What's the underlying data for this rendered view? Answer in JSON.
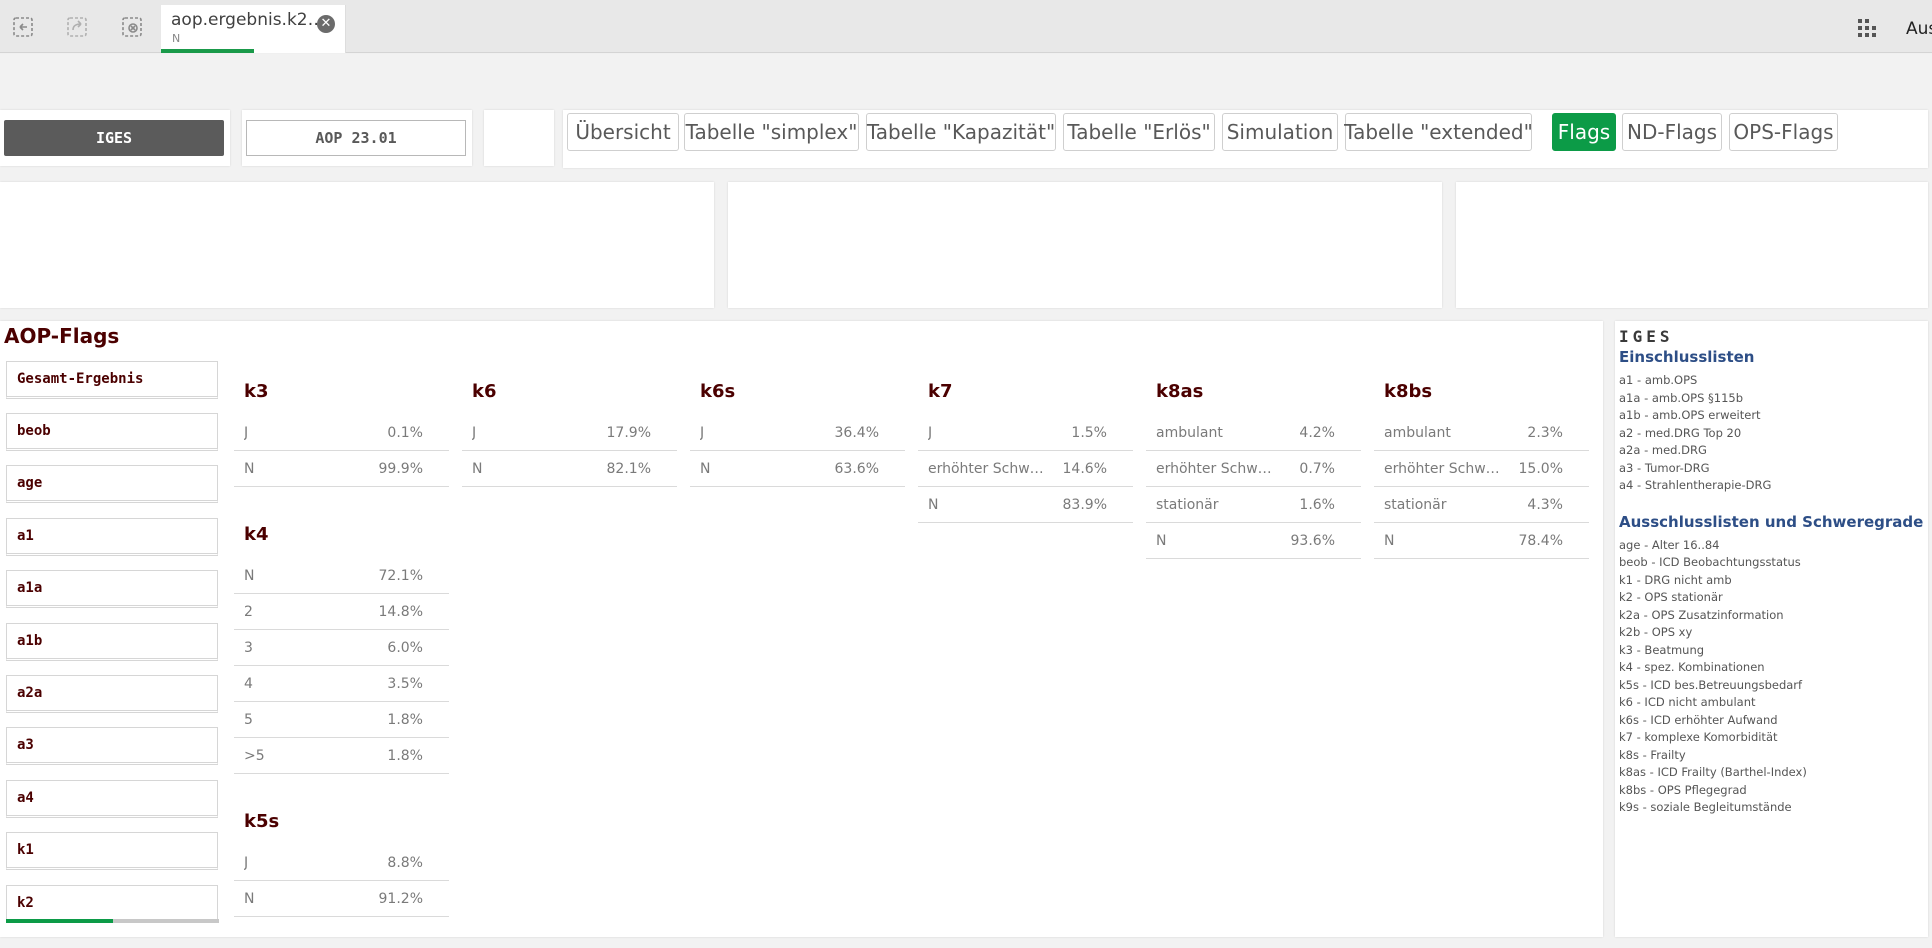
{
  "topbar": {
    "sheet_title": "aop.ergebnis.k2…",
    "sheet_sub": "N",
    "right_text": "Aus"
  },
  "selectors": {
    "iges": "IGES",
    "aop": "AOP 23.01"
  },
  "nav": [
    {
      "label": "Übersicht",
      "active": false
    },
    {
      "label": "Tabelle \"simplex\"",
      "active": false
    },
    {
      "label": "Tabelle \"Kapazität\"",
      "active": false
    },
    {
      "label": "Tabelle \"Erlös\"",
      "active": false
    },
    {
      "label": "Simulation",
      "active": false
    },
    {
      "label": "Tabelle \"extended\"",
      "active": false
    },
    {
      "label": "Flags",
      "active": true
    },
    {
      "label": "ND-Flags",
      "active": false
    },
    {
      "label": "OPS-Flags",
      "active": false
    }
  ],
  "flags": {
    "title": "AOP-Flags",
    "list": [
      "Gesamt-Ergebnis",
      "beob",
      "age",
      "a1",
      "a1a",
      "a1b",
      "a2a",
      "a3",
      "a4",
      "k1",
      "k2"
    ],
    "tables": {
      "k3": {
        "title": "k3",
        "rows": [
          {
            "label": "J",
            "value": "0.1%"
          },
          {
            "label": "N",
            "value": "99.9%"
          }
        ]
      },
      "k4": {
        "title": "k4",
        "rows": [
          {
            "label": "N",
            "value": "72.1%"
          },
          {
            "label": "2",
            "value": "14.8%"
          },
          {
            "label": "3",
            "value": "6.0%"
          },
          {
            "label": "4",
            "value": "3.5%"
          },
          {
            "label": "5",
            "value": "1.8%"
          },
          {
            "label": ">5",
            "value": "1.8%"
          }
        ]
      },
      "k5s": {
        "title": "k5s",
        "rows": [
          {
            "label": "J",
            "value": "8.8%"
          },
          {
            "label": "N",
            "value": "91.2%"
          }
        ]
      },
      "k6": {
        "title": "k6",
        "rows": [
          {
            "label": "J",
            "value": "17.9%"
          },
          {
            "label": "N",
            "value": "82.1%"
          }
        ]
      },
      "k6s": {
        "title": "k6s",
        "rows": [
          {
            "label": "J",
            "value": "36.4%"
          },
          {
            "label": "N",
            "value": "63.6%"
          }
        ]
      },
      "k7": {
        "title": "k7",
        "rows": [
          {
            "label": "J",
            "value": "1.5%"
          },
          {
            "label": "erhöhter Schwere...",
            "value": "14.6%"
          },
          {
            "label": "N",
            "value": "83.9%"
          }
        ]
      },
      "k8as": {
        "title": "k8as",
        "rows": [
          {
            "label": "ambulant",
            "value": "4.2%"
          },
          {
            "label": "erhöhter Schwere...",
            "value": "0.7%"
          },
          {
            "label": "stationär",
            "value": "1.6%"
          },
          {
            "label": "N",
            "value": "93.6%"
          }
        ]
      },
      "k8bs": {
        "title": "k8bs",
        "rows": [
          {
            "label": "ambulant",
            "value": "2.3%"
          },
          {
            "label": "erhöhter Schwereg...",
            "value": "15.0%"
          },
          {
            "label": "stationär",
            "value": "4.3%"
          },
          {
            "label": "N",
            "value": "78.4%"
          }
        ]
      }
    }
  },
  "legend": {
    "brand": "IGES",
    "incl_title": "Einschlusslisten",
    "incl": [
      "a1 - amb.OPS",
      "a1a - amb.OPS §115b",
      "a1b - amb.OPS erweitert",
      "a2 - med.DRG Top 20",
      "a2a - med.DRG",
      "a3 - Tumor-DRG",
      "a4 - Strahlentherapie-DRG"
    ],
    "excl_title": "Ausschlusslisten und Schweregrade",
    "excl": [
      "age - Alter 16..84",
      "beob - ICD Beobachtungsstatus",
      "k1 - DRG nicht amb",
      "k2 - OPS stationär",
      "k2a - OPS Zusatzinformation",
      "k2b - OPS xy",
      "k3 - Beatmung",
      "k4 - spez. Kombinationen",
      "k5s - ICD bes.Betreuungsbedarf",
      "k6 - ICD nicht ambulant",
      "k6s - ICD erhöhter Aufwand",
      "k7 - komplexe Komorbidität",
      "k8s - Frailty",
      "k8as - ICD Frailty (Barthel-Index)",
      "k8bs - OPS Pflegegrad",
      "k9s - soziale Begleitumstände"
    ]
  },
  "colors": {
    "accent": "#0c9b47",
    "title_dark_red": "#4b0000",
    "legend_blue": "#2d4e86"
  }
}
